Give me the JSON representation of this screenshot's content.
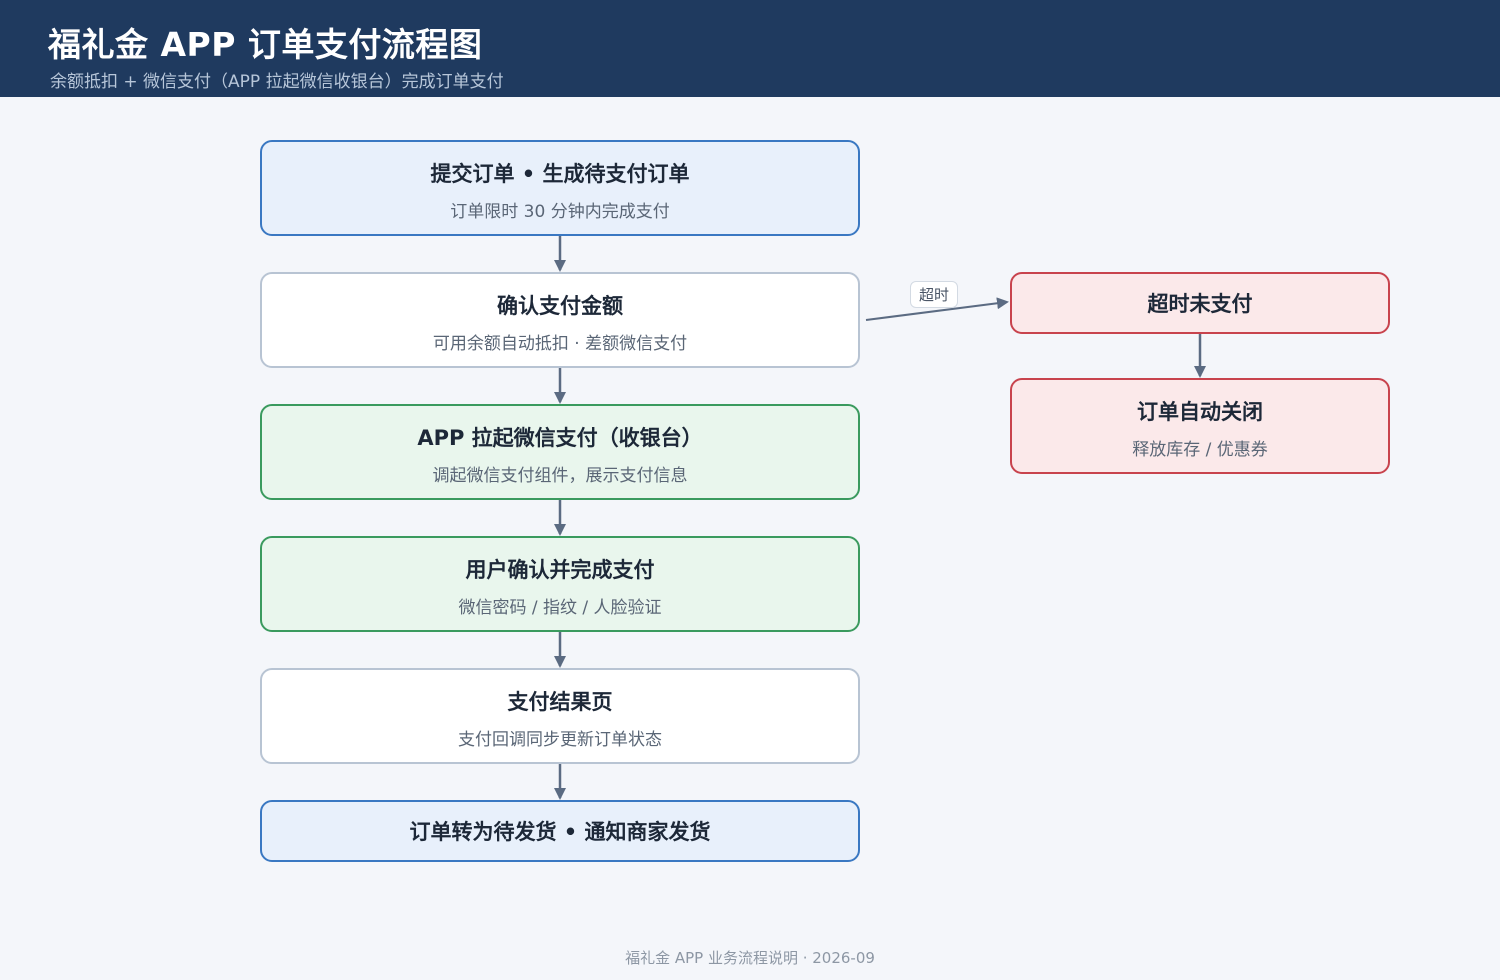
{
  "header": {
    "title": "福礼金 APP 订单支付流程图",
    "subtitle": "余额抵扣 + 微信支付（APP 拉起微信收银台）完成订单支付"
  },
  "nodes": {
    "submit": {
      "title": "提交订单 • 生成待支付订单",
      "sub": "订单限时 30 分钟内完成支付"
    },
    "confirm_amount": {
      "title": "确认支付金额",
      "sub": "可用余额自动抵扣 · 差额微信支付"
    },
    "wechat_cashier": {
      "title": "APP 拉起微信支付（收银台）",
      "sub": "调起微信支付组件，展示支付信息"
    },
    "user_pay": {
      "title": "用户确认并完成支付",
      "sub": "微信密码 / 指纹 / 人脸验证"
    },
    "result_page": {
      "title": "支付结果页",
      "sub": "支付回调同步更新订单状态"
    },
    "to_ship": {
      "title": "订单转为待发货 • 通知商家发货"
    },
    "timeout": {
      "title": "超时未支付"
    },
    "auto_close": {
      "title": "订单自动关闭",
      "sub": "释放库存 / 优惠券"
    }
  },
  "edges": {
    "timeout_label": "超时"
  },
  "colors": {
    "header_bg": "#1f3a5f",
    "blue_node": "#e8f0fb",
    "green_node": "#e9f6ed",
    "red_node": "#fbe9ea",
    "arrow": "#5b6b82"
  },
  "footer": {
    "text": "福礼金 APP 业务流程说明 · 2026-09"
  }
}
